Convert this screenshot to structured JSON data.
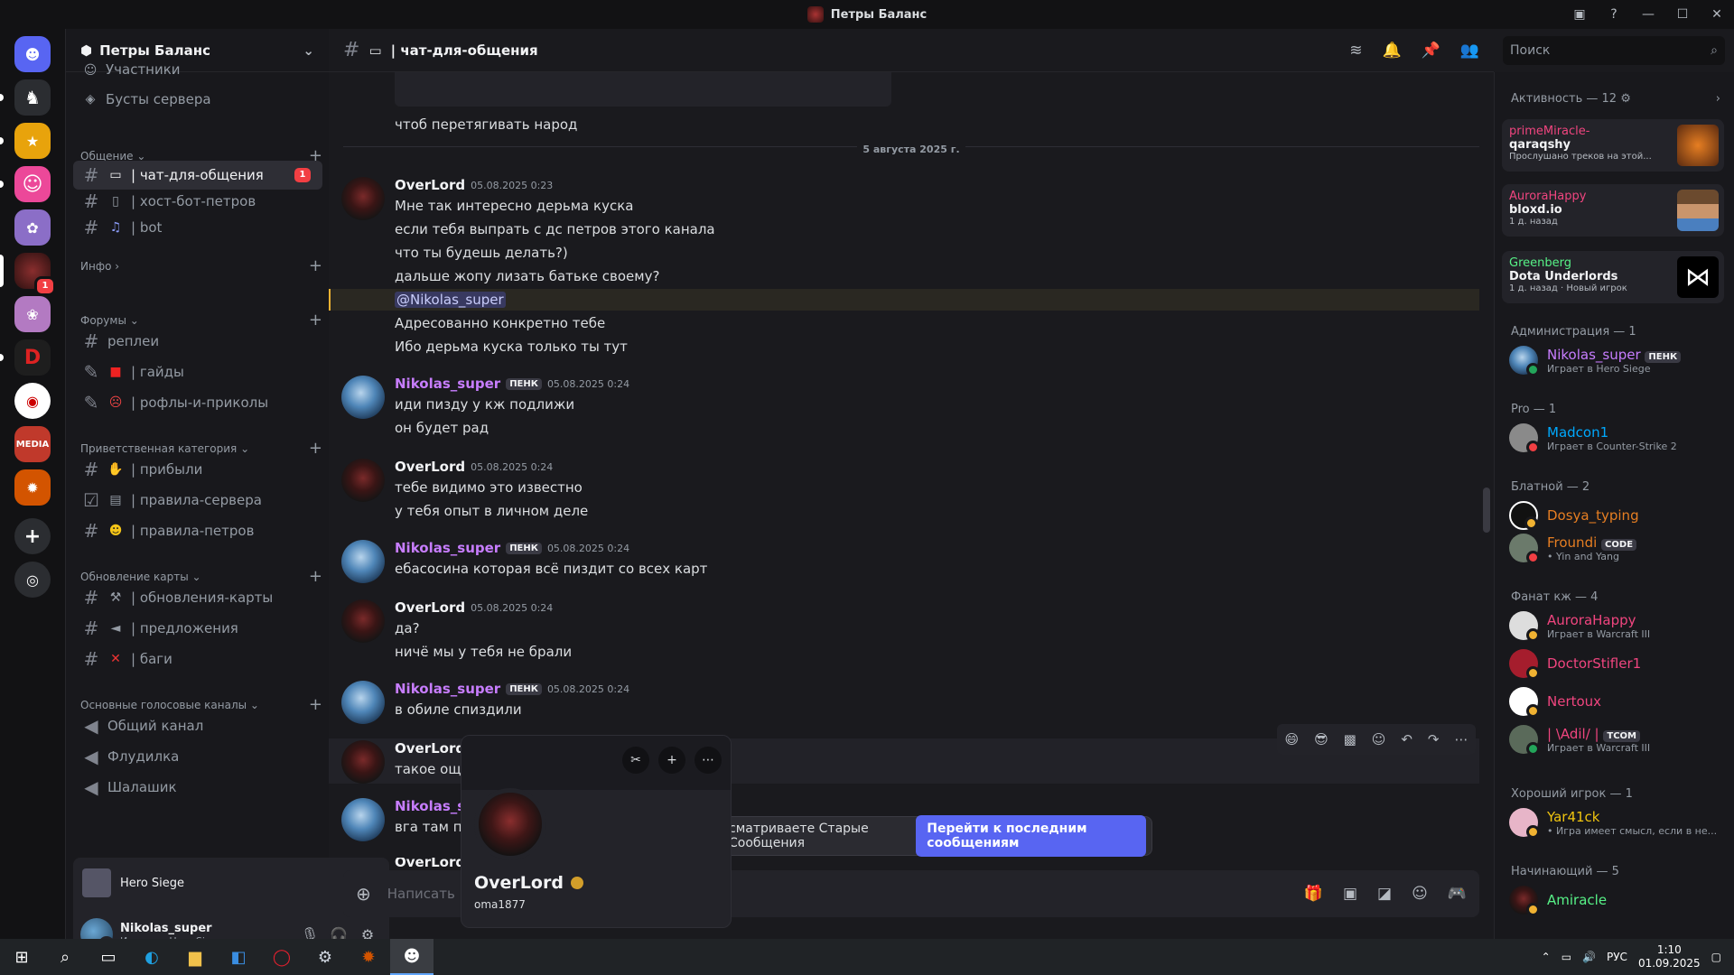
{
  "window": {
    "title": "Петры Баланс"
  },
  "guild": {
    "name": "Петры Баланс",
    "partial_top_item": "Участники",
    "boosts": "Бусты сервера"
  },
  "categories": {
    "talk": "Общение",
    "info": "Инфо",
    "forums": "Форумы",
    "welcome": "Приветственная категория",
    "map": "Обновление карты",
    "voice": "Основные голосовые каналы"
  },
  "channels": {
    "chat": "| чат-для-общения",
    "chat_badge": "1",
    "host": "| хост-бот-петров",
    "bot": "| bot",
    "replays": "реплеи",
    "guides": "| гайды",
    "memes": "| рофлы-и-приколы",
    "arrived": "| прибыли",
    "rules_server": "| правила-сервера",
    "rules_petrov": "| правила-петров",
    "map_updates": "| обновления-карты",
    "suggestions": "| предложения",
    "bugs": "| баги",
    "voice_general": "Общий канал",
    "voice_flood": "Флудилка",
    "voice_shalash": "Шалашик"
  },
  "activity_panel": {
    "game": "Hero Siege"
  },
  "user_panel": {
    "name": "Nikolas_super",
    "status": "Играет в Hero Siege"
  },
  "header": {
    "channel": "| чат-для-общения",
    "search_placeholder": "Поиск"
  },
  "chat": {
    "prev_line": "чтоб перетягивать народ",
    "date_separator": "5 августа 2025 г.",
    "messages": [
      {
        "author": "OverLord",
        "time": "05.08.2025 0:23",
        "lines": [
          "Мне так интересно дерьма куска",
          "если тебя выпрать с дс петров этого канала",
          "что ты будешь делать?)",
          "дальше жопу лизать батьке своему?"
        ]
      },
      {
        "mention": "@Nikolas_super",
        "lines": [
          "Адресованно конкретно тебе",
          "Ибо дерьма куска только ты тут"
        ]
      },
      {
        "author": "Nikolas_super",
        "tag": "ПЕНК",
        "time": "05.08.2025 0:24",
        "lines": [
          "иди пизду у кж подлижи",
          "он будет рад"
        ]
      },
      {
        "author": "OverLord",
        "time": "05.08.2025 0:24",
        "lines": [
          "тебе видимо это известно",
          "у тебя опыт в личном деле"
        ]
      },
      {
        "author": "Nikolas_super",
        "tag": "ПЕНК",
        "time": "05.08.2025 0:24",
        "lines": [
          "ебасосина которая всё пиздит со всех карт"
        ]
      },
      {
        "author": "OverLord",
        "time": "05.08.2025 0:24",
        "lines": [
          "да?",
          "ничё мы у тебя не брали"
        ]
      },
      {
        "author": "Nikolas_super",
        "tag": "ПЕНК",
        "time": "05.08.2025 0:24",
        "lines": [
          "в обиле спиздили"
        ]
      },
      {
        "author": "OverLord",
        "lines": [
          "такое ощу"
        ]
      },
      {
        "author": "Nikolas_su",
        "lines": [
          "вга там пиз"
        ]
      },
      {
        "author": "OverLord"
      }
    ],
    "composer_placeholder": "Написать",
    "jump_text": "сматриваете Старые Сообщения",
    "jump_button": "Перейти к последним сообщениям"
  },
  "popout": {
    "name": "OverLord",
    "username": "oma1877"
  },
  "members": {
    "activity_title": "Активность — 12",
    "activities": [
      {
        "user": "primeMiracle-",
        "title": "qaraqshy",
        "sub": "Прослушано треков на этой..."
      },
      {
        "user": "AuroraHappy",
        "title": "bloxd.io",
        "sub": "1 д. назад"
      },
      {
        "user": "Greenberg",
        "title": "Dota Underlords",
        "sub": "1 д. назад",
        "sub2": "Новый игрок"
      }
    ],
    "sections": {
      "admin": "Администрация — 1",
      "pro": "Pro — 1",
      "blatnoy": "Блатной — 2",
      "fan": "Фанат кж — 4",
      "good": "Хороший игрок — 1",
      "beginner": "Начинающий — 5"
    },
    "list": {
      "nikolas": {
        "name": "Nikolas_super",
        "tag": "ПЕНК",
        "sub": "Играет в Hero Siege"
      },
      "madcon": {
        "name": "Madcon1",
        "sub": "Играет в Counter-Strike 2"
      },
      "dosya": {
        "name": "Dosya_typing"
      },
      "froundi": {
        "name": "Froundi",
        "tag": "CODE",
        "sub": "• Yin and Yang"
      },
      "aurora": {
        "name": "AuroraHappy",
        "sub": "Играет в Warcraft III"
      },
      "doctor": {
        "name": "DoctorStifler1"
      },
      "nertoux": {
        "name": "Nertoux"
      },
      "adil": {
        "name": "| \\Adil/ |",
        "tag": "TCOM",
        "sub": "Играет в Warcraft III"
      },
      "yar": {
        "name": "Yar41ck",
        "sub": "• Игра имеет смысл, если в не..."
      },
      "amiracle": {
        "name": "Amiracle"
      }
    }
  },
  "taskbar": {
    "lang": "РУС",
    "time": "1:10",
    "date": "01.09.2025"
  },
  "colors": {
    "accent": "#5865f2",
    "admin": "#c77dff",
    "pro": "#00a8fc",
    "blatnoy": "#e67e22",
    "fan": "#f0457f",
    "good": "#f0c40f",
    "beginner": "#57f287"
  }
}
